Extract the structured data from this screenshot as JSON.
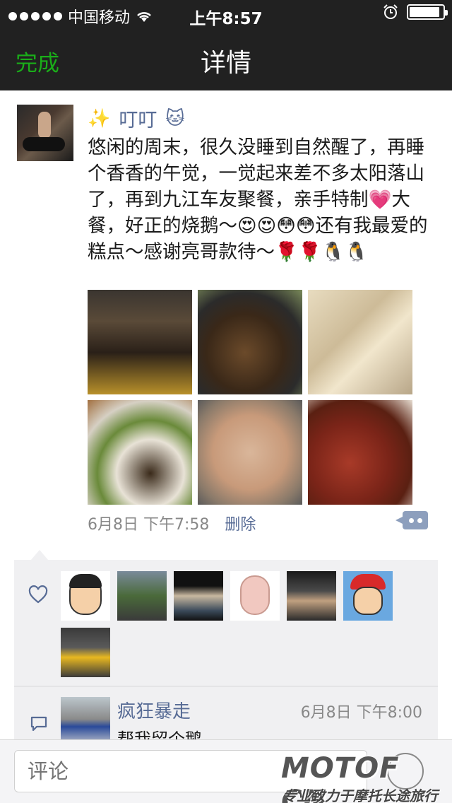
{
  "status_bar": {
    "carrier": "中国移动",
    "time": "上午8:57",
    "battery_level": 0.92
  },
  "nav": {
    "done_label": "完成",
    "title": "详情"
  },
  "post": {
    "author": "叮叮",
    "text": "悠闲的周末，很久没睡到自然醒了，再睡个香香的午觉，一觉起来差不多太阳落山了，再到九江车友聚餐，亲手特制💗大餐，好正的烧鹅～😍😍😳😳还有我最爱的糕点～感谢亮哥款待～🌹🌹🐧🐧",
    "date": "6月8日 下午7:58",
    "delete_label": "删除",
    "photos": [
      "motorcycles-night",
      "stir-fry-dish",
      "cakes",
      "dishes-table",
      "fried-rice",
      "roast-goose"
    ]
  },
  "likes": {
    "avatars": [
      "cartoon-boy",
      "man-outdoor",
      "beach-scene",
      "pig-cartoon",
      "group-photo",
      "cartoon-cap-boy",
      "yellow-sports-car"
    ]
  },
  "comment": {
    "author": "疯狂暴走",
    "time": "6月8日 下午8:00",
    "text": "帮我留个鹅"
  },
  "input": {
    "placeholder": "评论"
  },
  "watermark": {
    "logo": "MOTOF CN",
    "tagline": "专业致力于摩托长途旅行"
  },
  "colors": {
    "accent": "#1aad19",
    "link": "#576b95",
    "nav_bg": "#212121"
  }
}
